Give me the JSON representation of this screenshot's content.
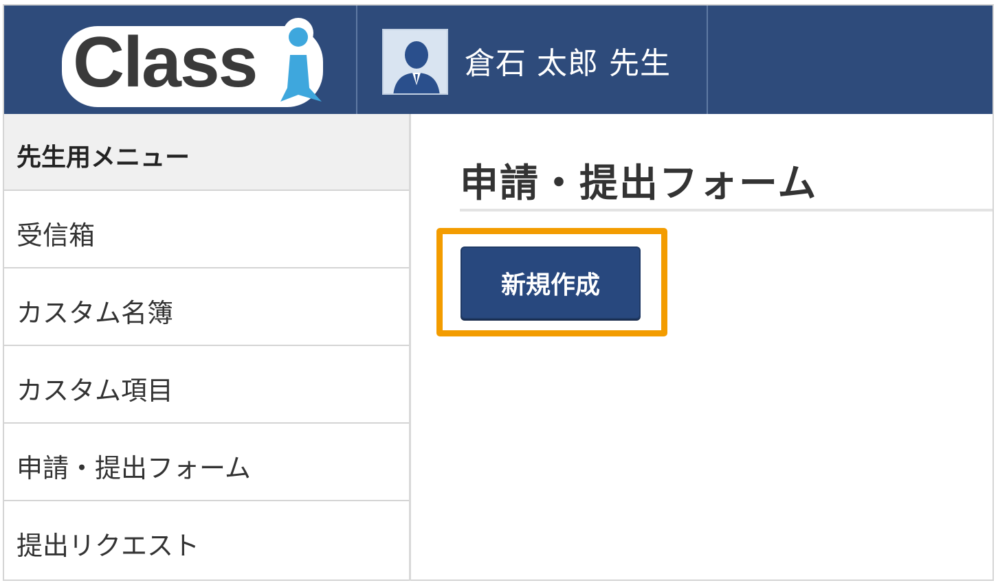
{
  "header": {
    "logo_text": "Classi",
    "user_name": "倉石 太郎 先生"
  },
  "sidebar": {
    "title": "先生用メニュー",
    "items": [
      {
        "label": "受信箱"
      },
      {
        "label": "カスタム名簿"
      },
      {
        "label": "カスタム項目"
      },
      {
        "label": "申請・提出フォーム"
      },
      {
        "label": "提出リクエスト"
      }
    ]
  },
  "main": {
    "title": "申請・提出フォーム",
    "new_button_label": "新規作成"
  },
  "colors": {
    "header_bg": "#2e4b7b",
    "button_bg": "#28487e",
    "highlight": "#f39c00"
  },
  "icons": {
    "avatar": "user-avatar-icon"
  }
}
